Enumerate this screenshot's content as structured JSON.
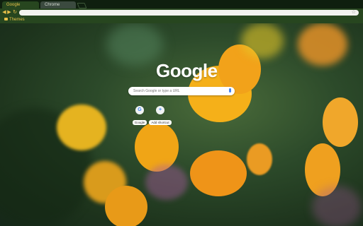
{
  "tabs": [
    {
      "label": "Google"
    },
    {
      "label": "Chrome"
    }
  ],
  "bookmarks": {
    "items": [
      {
        "label": "Themes"
      }
    ]
  },
  "ntp": {
    "logo": "Google",
    "search_placeholder": "Search Google or type a URL",
    "shortcuts": [
      {
        "label": "Google",
        "icon": "G"
      },
      {
        "label": "Add shortcut",
        "icon": "+"
      }
    ]
  },
  "theme": {
    "accent": "#e8c14a",
    "frame": "#0f1f0f",
    "toolbar": "#27461f"
  }
}
